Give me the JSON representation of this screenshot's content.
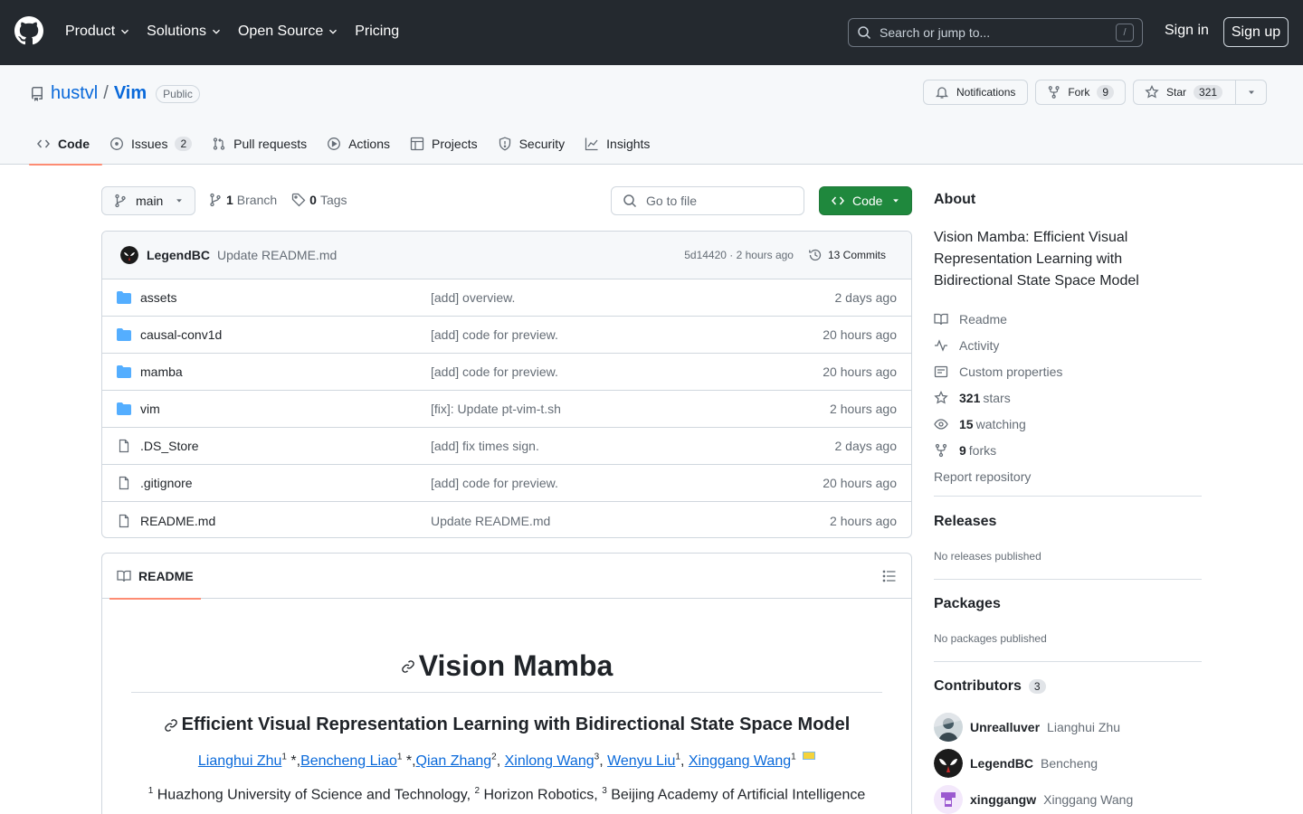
{
  "header": {
    "nav": [
      "Product",
      "Solutions",
      "Open Source",
      "Pricing"
    ],
    "search_placeholder": "Search or jump to...",
    "search_key": "/",
    "sign_in": "Sign in",
    "sign_up": "Sign up"
  },
  "repo": {
    "owner": "hustvl",
    "separator": "/",
    "name": "Vim",
    "visibility": "Public",
    "notifications": "Notifications",
    "fork_label": "Fork",
    "fork_count": "9",
    "star_label": "Star",
    "star_count": "321",
    "tabs": [
      {
        "label": "Code"
      },
      {
        "label": "Issues",
        "count": "2"
      },
      {
        "label": "Pull requests"
      },
      {
        "label": "Actions"
      },
      {
        "label": "Projects"
      },
      {
        "label": "Security"
      },
      {
        "label": "Insights"
      }
    ]
  },
  "files": {
    "branch": "main",
    "branch_count": "1",
    "branch_label": "Branch",
    "tag_count": "0",
    "tag_label": "Tags",
    "go_to_file": "Go to file",
    "code_button": "Code",
    "latest_commit": {
      "author": "LegendBC",
      "message": "Update README.md",
      "hash_time": "5d14420 · 2 hours ago",
      "commits": "13 Commits"
    },
    "rows": [
      {
        "type": "folder",
        "name": "assets",
        "commit": "[add] overview.",
        "time": "2 days ago"
      },
      {
        "type": "folder",
        "name": "causal-conv1d",
        "commit": "[add] code for preview.",
        "time": "20 hours ago"
      },
      {
        "type": "folder",
        "name": "mamba",
        "commit": "[add] code for preview.",
        "time": "20 hours ago"
      },
      {
        "type": "folder",
        "name": "vim",
        "commit": "[fix]: Update pt-vim-t.sh",
        "time": "2 hours ago"
      },
      {
        "type": "file",
        "name": ".DS_Store",
        "commit": "[add] fix times sign.",
        "time": "2 days ago"
      },
      {
        "type": "file",
        "name": ".gitignore",
        "commit": "[add] code for preview.",
        "time": "20 hours ago"
      },
      {
        "type": "file",
        "name": "README.md",
        "commit": "Update README.md",
        "time": "2 hours ago"
      }
    ]
  },
  "readme": {
    "tab": "README",
    "title": "Vision Mamba",
    "subtitle": "Efficient Visual Representation Learning with Bidirectional State Space Model",
    "authors": [
      {
        "name": "Lianghui Zhu",
        "sup": "1",
        "after": " *,"
      },
      {
        "name": "Bencheng Liao",
        "sup": "1",
        "after": " *,"
      },
      {
        "name": "Qian Zhang",
        "sup": "2",
        "after": ", "
      },
      {
        "name": "Xinlong Wang",
        "sup": "3",
        "after": ", "
      },
      {
        "name": "Wenyu Liu",
        "sup": "1",
        "after": ", "
      },
      {
        "name": "Xinggang Wang",
        "sup": "1",
        "after": " "
      }
    ],
    "affiliations": [
      {
        "sup": "1",
        "text": " Huazhong University of Science and Technology, "
      },
      {
        "sup": "2",
        "text": " Horizon Robotics, "
      },
      {
        "sup": "3",
        "text": " Beijing Academy of Artificial Intelligence"
      }
    ]
  },
  "sidebar": {
    "about_title": "About",
    "description": "Vision Mamba: Efficient Visual Representation Learning with Bidirectional State Space Model",
    "links": {
      "readme": "Readme",
      "activity": "Activity",
      "custom_properties": "Custom properties",
      "stars_count": "321",
      "stars_label": "stars",
      "watching_count": "15",
      "watching_label": "watching",
      "forks_count": "9",
      "forks_label": "forks",
      "report": "Report repository"
    },
    "releases_title": "Releases",
    "releases_note": "No releases published",
    "packages_title": "Packages",
    "packages_note": "No packages published",
    "contributors_title": "Contributors",
    "contributors_count": "3",
    "contributors": [
      {
        "login": "Unrealluver",
        "name": "Lianghui Zhu"
      },
      {
        "login": "LegendBC",
        "name": "Bencheng"
      },
      {
        "login": "xinggangw",
        "name": "Xinggang Wang"
      }
    ]
  },
  "colors": {
    "header_bg": "#24292f",
    "link": "#0969da",
    "primary_button": "#1f883d",
    "active_tab_underline": "#fd8c73",
    "folder_icon": "#54aeff"
  }
}
